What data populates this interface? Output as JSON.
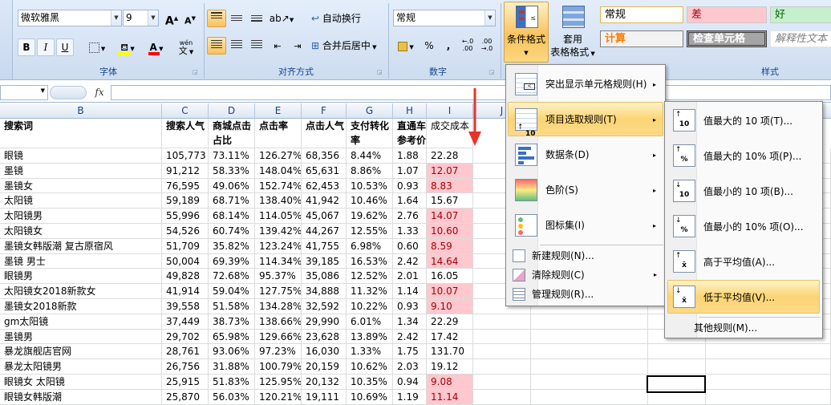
{
  "ribbon": {
    "font": {
      "name": "微软雅黑",
      "size": "9",
      "label": "字体",
      "grow": "A",
      "shrink": "A",
      "bold": "B",
      "italic": "I",
      "underline": "U",
      "font_color_glyph": "A",
      "wen": "wén",
      "wen_char": "文"
    },
    "align": {
      "wrap_text": "自动换行",
      "merge_center": "合并后居中",
      "label": "对齐方式"
    },
    "number": {
      "format": "常规",
      "percent": "%",
      "comma": ",",
      "label": "数字"
    },
    "styles": {
      "cond_format": "条件格式",
      "table_format_1": "套用",
      "table_format_2": "表格格式",
      "normal": "常规",
      "bad": "差",
      "good": "好",
      "calc": "计算",
      "check_cell": "检查单元格",
      "explanatory": "解释性文本",
      "label": "样式",
      "colors": {
        "bad_bg": "#ffc7ce",
        "bad_fg": "#9c0006",
        "good_bg": "#c6efce",
        "good_fg": "#006100",
        "calc_bg": "#f2f2f2",
        "calc_fg": "#fa7d00",
        "check_bg": "#a5a5a5"
      }
    }
  },
  "formula_bar": {
    "fx": "fx",
    "value": ""
  },
  "columns": [
    "B",
    "C",
    "D",
    "E",
    "F",
    "G",
    "H",
    "I",
    "J"
  ],
  "table": {
    "headers": [
      [
        "搜索词",
        ""
      ],
      [
        "搜索人气",
        ""
      ],
      [
        "商城点击",
        "占比"
      ],
      [
        "点击率",
        ""
      ],
      [
        "点击人气",
        ""
      ],
      [
        "支付转化",
        "率"
      ],
      [
        "直通车",
        "参考价"
      ],
      [
        "成交成本",
        ""
      ]
    ],
    "rows": [
      [
        "眼镜",
        "105,773",
        "73.11%",
        "126.27%",
        "68,356",
        "8.44%",
        "1.88",
        "22.28"
      ],
      [
        "墨镜",
        "91,212",
        "58.33%",
        "148.04%",
        "65,631",
        "8.86%",
        "1.07",
        "12.07"
      ],
      [
        "墨镜女",
        "76,595",
        "49.06%",
        "152.74%",
        "62,453",
        "10.53%",
        "0.93",
        "8.83"
      ],
      [
        "太阳镜",
        "59,189",
        "68.71%",
        "138.40%",
        "41,942",
        "10.46%",
        "1.64",
        "15.67"
      ],
      [
        "太阳镜男",
        "55,996",
        "68.14%",
        "114.05%",
        "45,067",
        "19.62%",
        "2.76",
        "14.07"
      ],
      [
        "太阳镜女",
        "54,526",
        "60.74%",
        "139.42%",
        "44,267",
        "12.55%",
        "1.33",
        "10.60"
      ],
      [
        "墨镜女韩版潮 复古原宿风",
        "51,709",
        "35.82%",
        "123.24%",
        "41,755",
        "6.98%",
        "0.60",
        "8.59"
      ],
      [
        "墨镜 男士",
        "50,004",
        "69.39%",
        "114.34%",
        "39,185",
        "16.53%",
        "2.42",
        "14.64"
      ],
      [
        "眼镜男",
        "49,828",
        "72.68%",
        "95.37%",
        "35,086",
        "12.52%",
        "2.01",
        "16.05"
      ],
      [
        "太阳镜女2018新款女",
        "41,914",
        "59.04%",
        "127.75%",
        "34,888",
        "11.32%",
        "1.14",
        "10.07"
      ],
      [
        "墨镜女2018新款",
        "39,558",
        "51.58%",
        "134.28%",
        "32,592",
        "10.22%",
        "0.93",
        "9.10"
      ],
      [
        "gm太阳镜",
        "37,449",
        "38.73%",
        "138.66%",
        "29,990",
        "6.01%",
        "1.34",
        "22.29"
      ],
      [
        "墨镜男",
        "29,702",
        "65.98%",
        "129.66%",
        "23,628",
        "13.89%",
        "2.42",
        "17.42"
      ],
      [
        "暴龙旗舰店官网",
        "28,761",
        "93.06%",
        "97.23%",
        "16,030",
        "1.33%",
        "1.75",
        "131.70"
      ],
      [
        "暴龙太阳镜男",
        "26,756",
        "31.88%",
        "100.79%",
        "20,159",
        "10.62%",
        "2.03",
        "19.12"
      ],
      [
        "眼镜女 太阳镜",
        "25,915",
        "51.83%",
        "125.95%",
        "20,132",
        "10.35%",
        "0.94",
        "9.08"
      ],
      [
        "眼镜女韩版潮",
        "25,870",
        "56.03%",
        "120.21%",
        "19,111",
        "10.69%",
        "1.19",
        "11.14"
      ]
    ],
    "highlighted_rows": [
      1,
      2,
      4,
      5,
      6,
      7,
      9,
      10,
      15,
      16
    ]
  },
  "menu": {
    "items": [
      {
        "label": "突出显示单元格规则(H)",
        "has_sub": true
      },
      {
        "label": "项目选取规则(T)",
        "has_sub": true
      },
      {
        "label": "数据条(D)",
        "has_sub": true
      },
      {
        "label": "色阶(S)",
        "has_sub": true
      },
      {
        "label": "图标集(I)",
        "has_sub": true
      }
    ],
    "small": [
      {
        "label": "新建规则(N)..."
      },
      {
        "label": "清除规则(C)",
        "has_sub": true
      },
      {
        "label": "管理规则(R)..."
      }
    ],
    "arrow": "▸"
  },
  "submenu": {
    "items": [
      {
        "label": "值最大的 10 项(T)...",
        "icon_text": "10"
      },
      {
        "label": "值最大的 10% 项(P)...",
        "icon_text": "%"
      },
      {
        "label": "值最小的 10 项(B)...",
        "icon_text": "10"
      },
      {
        "label": "值最小的 10% 项(O)...",
        "icon_text": "%"
      },
      {
        "label": "高于平均值(A)...",
        "icon_text": "x̄"
      },
      {
        "label": "低于平均值(V)...",
        "icon_text": "x̄"
      }
    ],
    "other": "其他规则(M)..."
  }
}
